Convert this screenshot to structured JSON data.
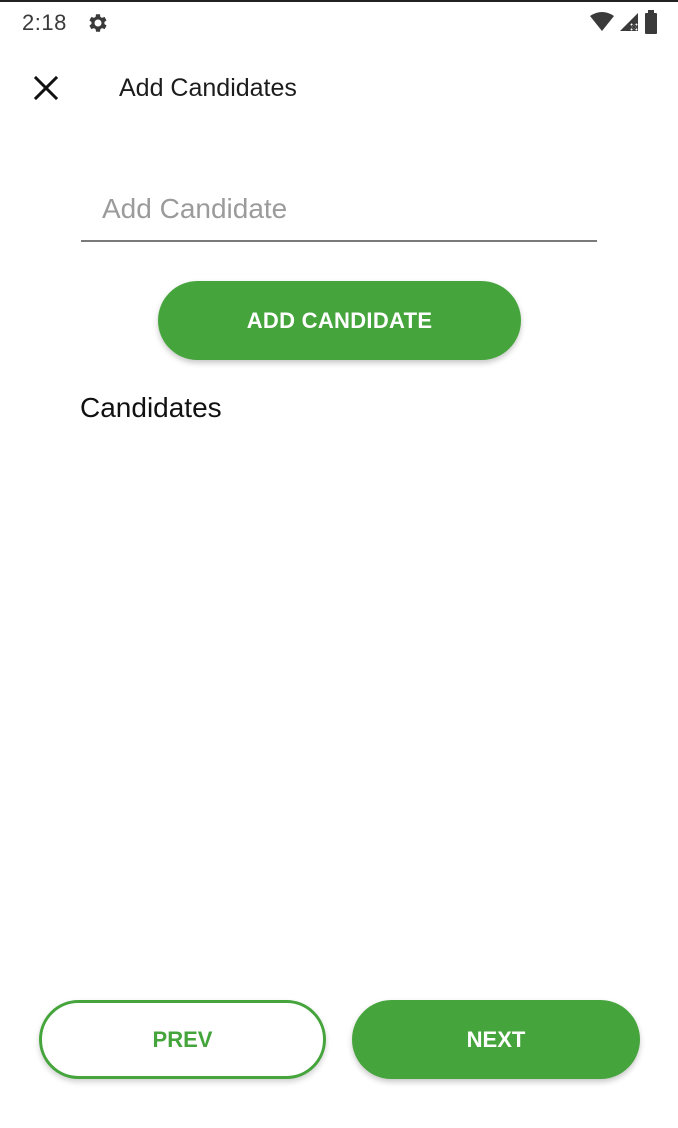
{
  "status_bar": {
    "time": "2:18",
    "icons": [
      "gear-icon",
      "wifi-icon",
      "signal-icon",
      "battery-icon"
    ]
  },
  "app_bar": {
    "title": "Add Candidates",
    "close_icon": "close-icon"
  },
  "candidate_input": {
    "value": "",
    "placeholder": "Add Candidate"
  },
  "add_button": {
    "label": "ADD CANDIDATE"
  },
  "candidates": {
    "heading": "Candidates",
    "items": []
  },
  "navigation": {
    "prev_label": "PREV",
    "next_label": "NEXT"
  },
  "colors": {
    "accent": "#45a53c",
    "background": "#ffffff",
    "text": "#1c1c1c",
    "placeholder": "#9b9b9b"
  }
}
